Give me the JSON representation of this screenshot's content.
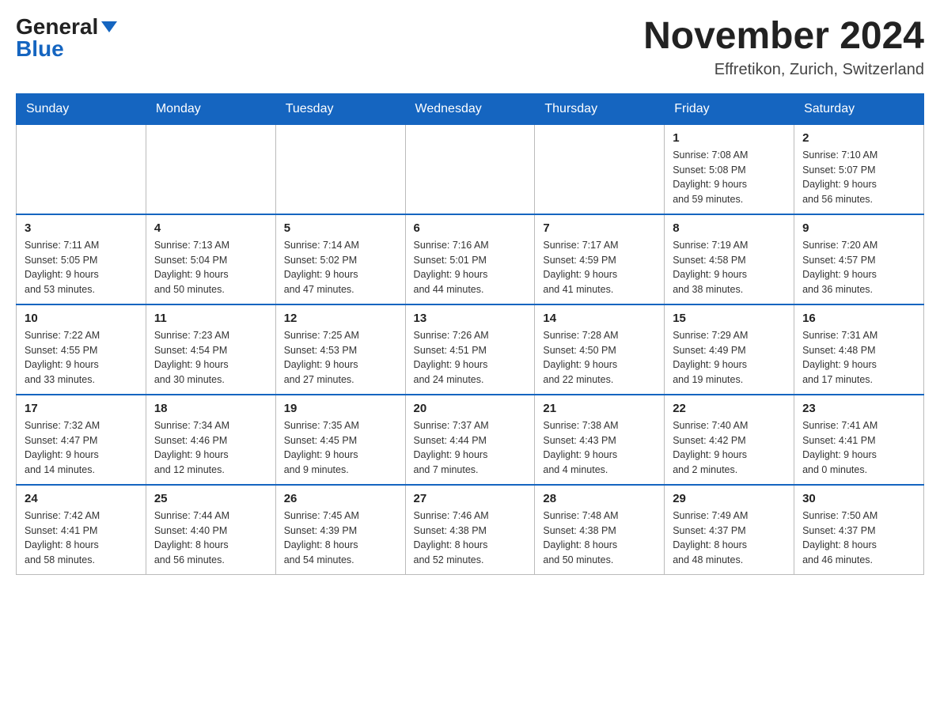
{
  "header": {
    "logo_general": "General",
    "logo_blue": "Blue",
    "month_title": "November 2024",
    "location": "Effretikon, Zurich, Switzerland"
  },
  "days_of_week": [
    "Sunday",
    "Monday",
    "Tuesday",
    "Wednesday",
    "Thursday",
    "Friday",
    "Saturday"
  ],
  "weeks": [
    [
      {
        "day": "",
        "info": ""
      },
      {
        "day": "",
        "info": ""
      },
      {
        "day": "",
        "info": ""
      },
      {
        "day": "",
        "info": ""
      },
      {
        "day": "",
        "info": ""
      },
      {
        "day": "1",
        "info": "Sunrise: 7:08 AM\nSunset: 5:08 PM\nDaylight: 9 hours\nand 59 minutes."
      },
      {
        "day": "2",
        "info": "Sunrise: 7:10 AM\nSunset: 5:07 PM\nDaylight: 9 hours\nand 56 minutes."
      }
    ],
    [
      {
        "day": "3",
        "info": "Sunrise: 7:11 AM\nSunset: 5:05 PM\nDaylight: 9 hours\nand 53 minutes."
      },
      {
        "day": "4",
        "info": "Sunrise: 7:13 AM\nSunset: 5:04 PM\nDaylight: 9 hours\nand 50 minutes."
      },
      {
        "day": "5",
        "info": "Sunrise: 7:14 AM\nSunset: 5:02 PM\nDaylight: 9 hours\nand 47 minutes."
      },
      {
        "day": "6",
        "info": "Sunrise: 7:16 AM\nSunset: 5:01 PM\nDaylight: 9 hours\nand 44 minutes."
      },
      {
        "day": "7",
        "info": "Sunrise: 7:17 AM\nSunset: 4:59 PM\nDaylight: 9 hours\nand 41 minutes."
      },
      {
        "day": "8",
        "info": "Sunrise: 7:19 AM\nSunset: 4:58 PM\nDaylight: 9 hours\nand 38 minutes."
      },
      {
        "day": "9",
        "info": "Sunrise: 7:20 AM\nSunset: 4:57 PM\nDaylight: 9 hours\nand 36 minutes."
      }
    ],
    [
      {
        "day": "10",
        "info": "Sunrise: 7:22 AM\nSunset: 4:55 PM\nDaylight: 9 hours\nand 33 minutes."
      },
      {
        "day": "11",
        "info": "Sunrise: 7:23 AM\nSunset: 4:54 PM\nDaylight: 9 hours\nand 30 minutes."
      },
      {
        "day": "12",
        "info": "Sunrise: 7:25 AM\nSunset: 4:53 PM\nDaylight: 9 hours\nand 27 minutes."
      },
      {
        "day": "13",
        "info": "Sunrise: 7:26 AM\nSunset: 4:51 PM\nDaylight: 9 hours\nand 24 minutes."
      },
      {
        "day": "14",
        "info": "Sunrise: 7:28 AM\nSunset: 4:50 PM\nDaylight: 9 hours\nand 22 minutes."
      },
      {
        "day": "15",
        "info": "Sunrise: 7:29 AM\nSunset: 4:49 PM\nDaylight: 9 hours\nand 19 minutes."
      },
      {
        "day": "16",
        "info": "Sunrise: 7:31 AM\nSunset: 4:48 PM\nDaylight: 9 hours\nand 17 minutes."
      }
    ],
    [
      {
        "day": "17",
        "info": "Sunrise: 7:32 AM\nSunset: 4:47 PM\nDaylight: 9 hours\nand 14 minutes."
      },
      {
        "day": "18",
        "info": "Sunrise: 7:34 AM\nSunset: 4:46 PM\nDaylight: 9 hours\nand 12 minutes."
      },
      {
        "day": "19",
        "info": "Sunrise: 7:35 AM\nSunset: 4:45 PM\nDaylight: 9 hours\nand 9 minutes."
      },
      {
        "day": "20",
        "info": "Sunrise: 7:37 AM\nSunset: 4:44 PM\nDaylight: 9 hours\nand 7 minutes."
      },
      {
        "day": "21",
        "info": "Sunrise: 7:38 AM\nSunset: 4:43 PM\nDaylight: 9 hours\nand 4 minutes."
      },
      {
        "day": "22",
        "info": "Sunrise: 7:40 AM\nSunset: 4:42 PM\nDaylight: 9 hours\nand 2 minutes."
      },
      {
        "day": "23",
        "info": "Sunrise: 7:41 AM\nSunset: 4:41 PM\nDaylight: 9 hours\nand 0 minutes."
      }
    ],
    [
      {
        "day": "24",
        "info": "Sunrise: 7:42 AM\nSunset: 4:41 PM\nDaylight: 8 hours\nand 58 minutes."
      },
      {
        "day": "25",
        "info": "Sunrise: 7:44 AM\nSunset: 4:40 PM\nDaylight: 8 hours\nand 56 minutes."
      },
      {
        "day": "26",
        "info": "Sunrise: 7:45 AM\nSunset: 4:39 PM\nDaylight: 8 hours\nand 54 minutes."
      },
      {
        "day": "27",
        "info": "Sunrise: 7:46 AM\nSunset: 4:38 PM\nDaylight: 8 hours\nand 52 minutes."
      },
      {
        "day": "28",
        "info": "Sunrise: 7:48 AM\nSunset: 4:38 PM\nDaylight: 8 hours\nand 50 minutes."
      },
      {
        "day": "29",
        "info": "Sunrise: 7:49 AM\nSunset: 4:37 PM\nDaylight: 8 hours\nand 48 minutes."
      },
      {
        "day": "30",
        "info": "Sunrise: 7:50 AM\nSunset: 4:37 PM\nDaylight: 8 hours\nand 46 minutes."
      }
    ]
  ]
}
